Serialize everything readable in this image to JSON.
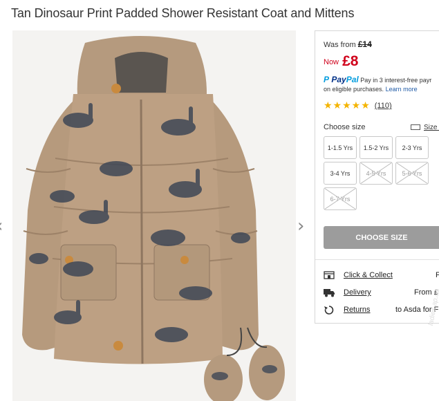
{
  "product": {
    "title": "Tan Dinosaur Print Padded Shower Resistant Coat and Mittens"
  },
  "gallery": {
    "prev_glyph": "‹",
    "next_glyph": "›"
  },
  "pricing": {
    "was_label": "Was from",
    "was_price": "£14",
    "now_label": "Now",
    "now_price": "£8"
  },
  "paypal": {
    "logo_pay": "Pay",
    "logo_pal": "Pal",
    "line1": "Pay in 3 interest-free payr",
    "line2": "on eligible purchases.",
    "learn_more": "Learn more"
  },
  "rating": {
    "stars": "★★★★★",
    "value": 5,
    "reviews": "(110)"
  },
  "sizes": {
    "label": "Choose size",
    "guide_label": "Size g",
    "options": [
      {
        "label": "1-1.5 Yrs",
        "available": true
      },
      {
        "label": "1.5-2 Yrs",
        "available": true
      },
      {
        "label": "2-3 Yrs",
        "available": true
      },
      {
        "label": "3-4 Yrs",
        "available": true
      },
      {
        "label": "4-5 Yrs",
        "available": false
      },
      {
        "label": "5-6 Yrs",
        "available": false
      },
      {
        "label": "6-7 Yrs",
        "available": false
      }
    ],
    "choose_button": "CHOOSE SIZE"
  },
  "delivery": [
    {
      "icon": "store-icon",
      "label": "Click & Collect",
      "detail": "F"
    },
    {
      "icon": "truck-icon",
      "label": "Delivery",
      "detail": "From £"
    },
    {
      "icon": "returns-icon",
      "label": "Returns",
      "detail": "to Asda for F"
    }
  ],
  "watermark": "ladies.ap.ua"
}
